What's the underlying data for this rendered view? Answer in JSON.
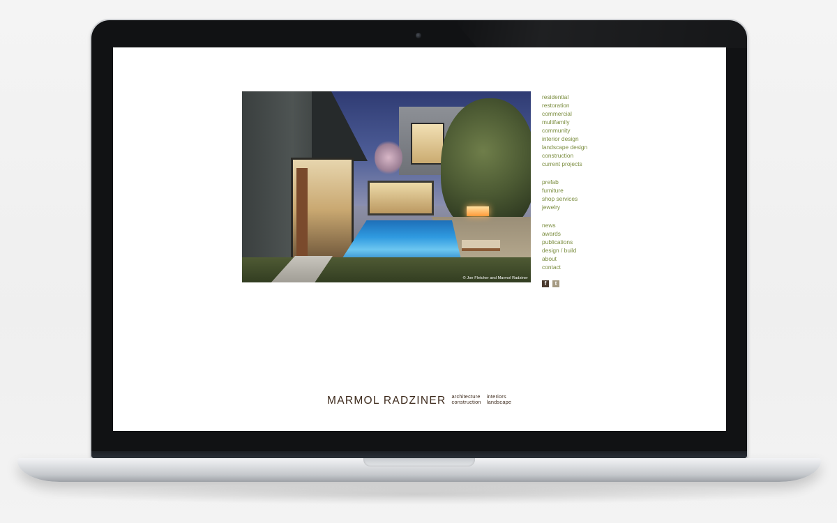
{
  "photo": {
    "credit": "© Joe Fletcher and Marmol Radziner"
  },
  "nav": {
    "groups": [
      [
        "residential",
        "restoration",
        "commercial",
        "multifamily",
        "community",
        "interior design",
        "landscape design",
        "construction",
        "current projects"
      ],
      [
        "prefab",
        "furniture",
        "shop services",
        "jewelry"
      ],
      [
        "news",
        "awards",
        "publications",
        "design / build",
        "about",
        "contact"
      ]
    ]
  },
  "social": {
    "facebook_glyph": "f",
    "twitter_glyph": "t"
  },
  "brand": {
    "name": "MARMOL RADZINER",
    "tagline": [
      "architecture",
      "construction",
      "interiors",
      "landscape"
    ]
  },
  "icons": {
    "facebook": "facebook-icon",
    "twitter": "twitter-icon"
  },
  "colors": {
    "nav_link": "#7b8d3f",
    "brand": "#3d2a1c",
    "facebook_bg": "#4a3a2e",
    "twitter_bg": "#a59a82"
  }
}
